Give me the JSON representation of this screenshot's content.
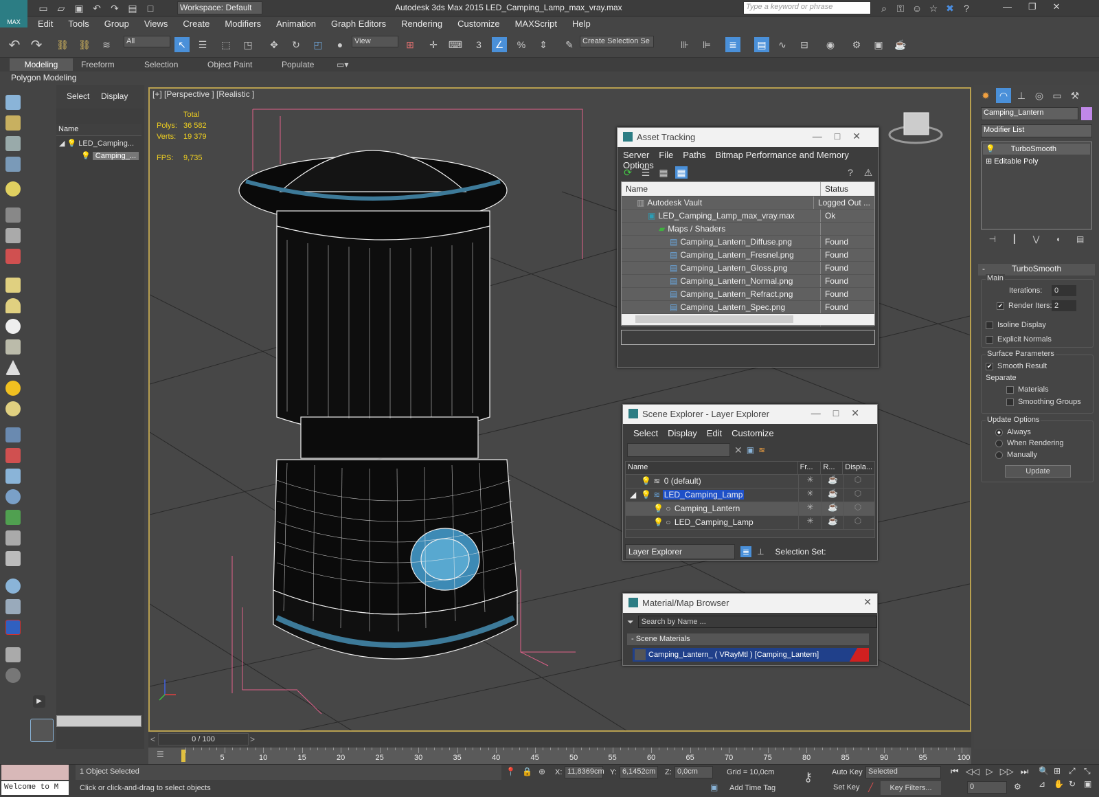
{
  "app": {
    "title": "Autodesk 3ds Max  2015    LED_Camping_Lamp_max_vray.max",
    "logo": "MAX",
    "workspace": "Workspace: Default",
    "search_placeholder": "Type a keyword or phrase"
  },
  "menu": [
    "Edit",
    "Tools",
    "Group",
    "Views",
    "Create",
    "Modifiers",
    "Animation",
    "Graph Editors",
    "Rendering",
    "Customize",
    "MAXScript",
    "Help"
  ],
  "toolbar": {
    "filter": "All",
    "ref_coord": "View",
    "selection_set": "Create Selection Se",
    "snap_angle": "3"
  },
  "ribbon": {
    "tabs": [
      "Modeling",
      "Freeform",
      "Selection",
      "Object Paint",
      "Populate"
    ],
    "sub": "Polygon Modeling"
  },
  "scene_panel": {
    "tabs": [
      "Select",
      "Display"
    ],
    "header": "Name",
    "items": [
      "LED_Camping...",
      "Camping_..."
    ]
  },
  "viewport": {
    "label": "[+] [Perspective ] [Realistic ]",
    "stats": {
      "total": "Total",
      "polys_label": "Polys:",
      "polys": "36 582",
      "verts_label": "Verts:",
      "verts": "19 379",
      "fps_label": "FPS:",
      "fps": "9,735"
    }
  },
  "asset_tracking": {
    "title": "Asset Tracking",
    "menu": [
      "Server",
      "File",
      "Paths",
      "Bitmap Performance and Memory",
      "Options"
    ],
    "cols": [
      "Name",
      "Status"
    ],
    "rows": [
      {
        "name": "Autodesk Vault",
        "status": "Logged Out ..."
      },
      {
        "name": "LED_Camping_Lamp_max_vray.max",
        "status": "Ok"
      },
      {
        "name": "Maps / Shaders",
        "status": ""
      },
      {
        "name": "Camping_Lantern_Diffuse.png",
        "status": "Found"
      },
      {
        "name": "Camping_Lantern_Fresnel.png",
        "status": "Found"
      },
      {
        "name": "Camping_Lantern_Gloss.png",
        "status": "Found"
      },
      {
        "name": "Camping_Lantern_Normal.png",
        "status": "Found"
      },
      {
        "name": "Camping_Lantern_Refract.png",
        "status": "Found"
      },
      {
        "name": "Camping_Lantern_Spec.png",
        "status": "Found"
      }
    ]
  },
  "scene_explorer": {
    "title": "Scene Explorer - Layer Explorer",
    "menu": [
      "Select",
      "Display",
      "Edit",
      "Customize"
    ],
    "cols": [
      "Name",
      "Fr...",
      "R...",
      "Displa..."
    ],
    "rows": [
      "0 (default)",
      "LED_Camping_Lamp",
      "Camping_Lantern",
      "LED_Camping_Lamp"
    ],
    "footer_mode": "Layer Explorer",
    "selection_set": "Selection Set:"
  },
  "material_browser": {
    "title": "Material/Map Browser",
    "search_placeholder": "Search by Name ...",
    "section": "- Scene Materials",
    "item": "Camping_Lantern_  ( VRayMtl )  [Camping_Lantern]"
  },
  "command_panel": {
    "object_name": "Camping_Lantern",
    "modifier_list": "Modifier List",
    "stack": [
      "TurboSmooth",
      "Editable Poly"
    ],
    "rollout": "TurboSmooth",
    "main": "Main",
    "iterations_label": "Iterations:",
    "iterations": "0",
    "render_iters_label": "Render Iters:",
    "render_iters": "2",
    "isoline": "Isoline Display",
    "explicit": "Explicit Normals",
    "surface": "Surface Parameters",
    "smooth_result": "Smooth Result",
    "separate": "Separate",
    "materials": "Materials",
    "smoothing_groups": "Smoothing Groups",
    "update_options": "Update Options",
    "always": "Always",
    "when_rendering": "When Rendering",
    "manually": "Manually",
    "update_btn": "Update"
  },
  "timeline": {
    "frame": "0 / 100",
    "ticks": [
      "5",
      "10",
      "15",
      "20",
      "25",
      "30",
      "35",
      "40",
      "45",
      "50",
      "55",
      "60",
      "65",
      "70",
      "75",
      "80",
      "85",
      "90",
      "95",
      "100"
    ]
  },
  "status": {
    "welcome": "Welcome to M",
    "selected": "1 Object Selected",
    "hint": "Click or click-and-drag to select objects",
    "x_label": "X:",
    "x": "11,8369cm",
    "y_label": "Y:",
    "y": "6,1452cm",
    "z_label": "Z:",
    "z": "0,0cm",
    "grid": "Grid = 10,0cm",
    "autokey": "Auto Key",
    "setkey": "Set Key",
    "selected_dd": "Selected",
    "key_filters": "Key Filters...",
    "add_time_tag": "Add Time Tag",
    "frame_field": "0"
  }
}
